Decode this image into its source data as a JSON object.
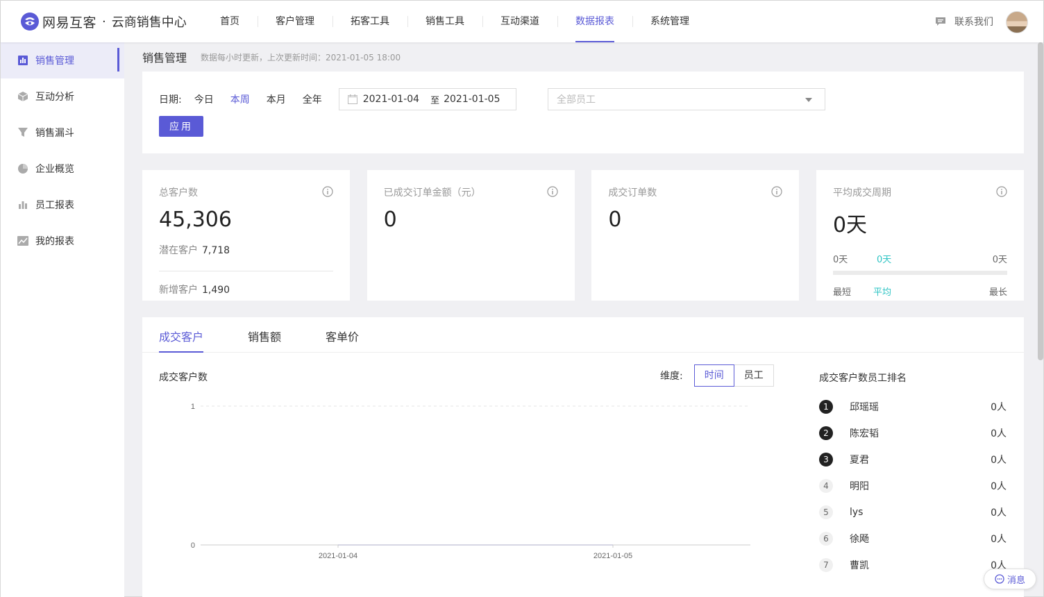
{
  "header": {
    "brand": "网易互客",
    "brand_dot": "·",
    "brand_sub": "云商销售中心",
    "nav": [
      "首页",
      "客户管理",
      "拓客工具",
      "销售工具",
      "互动渠道",
      "数据报表",
      "系统管理"
    ],
    "active_nav": "数据报表",
    "contact": "联系我们"
  },
  "sidebar": {
    "items": [
      {
        "label": "销售管理",
        "icon": "bar-chart-icon"
      },
      {
        "label": "互动分析",
        "icon": "cube-icon"
      },
      {
        "label": "销售漏斗",
        "icon": "funnel-icon"
      },
      {
        "label": "企业概览",
        "icon": "pie-chart-icon"
      },
      {
        "label": "员工报表",
        "icon": "column-chart-icon"
      },
      {
        "label": "我的报表",
        "icon": "line-chart-icon"
      }
    ],
    "active": "销售管理"
  },
  "page": {
    "title": "销售管理",
    "note": "数据每小时更新，上次更新时间：2021-01-05 18:00"
  },
  "filter": {
    "date_label": "日期:",
    "quick": [
      "今日",
      "本周",
      "本月",
      "全年"
    ],
    "active_quick": "本周",
    "date_start": "2021-01-04",
    "date_sep": "至",
    "date_end": "2021-01-05",
    "employee_placeholder": "全部员工",
    "apply_label": "应用"
  },
  "cards": {
    "total_customers": {
      "title": "总客户数",
      "value": "45,306",
      "potential_label": "潜在客户",
      "potential_value": "7,718",
      "new_label": "新增客户",
      "new_value": "1,490"
    },
    "deal_amount": {
      "title": "已成交订单金额（元）",
      "value": "0"
    },
    "deal_orders": {
      "title": "成交订单数",
      "value": "0"
    },
    "avg_cycle": {
      "title": "平均成交周期",
      "value": "0天",
      "min_value": "0天",
      "avg_value": "0天",
      "max_value": "0天",
      "min_label": "最短",
      "avg_label": "平均",
      "max_label": "最长"
    }
  },
  "panel": {
    "tabs": [
      "成交客户",
      "销售额",
      "客单价"
    ],
    "active_tab": "成交客户",
    "chart_title": "成交客户数",
    "dim_label": "维度:",
    "dim_options": [
      "时间",
      "员工"
    ],
    "dim_active": "时间",
    "rank_title": "成交客户数员工排名",
    "rank": [
      {
        "no": "1",
        "name": "邱瑶瑶",
        "value": "0人"
      },
      {
        "no": "2",
        "name": "陈宏韬",
        "value": "0人"
      },
      {
        "no": "3",
        "name": "夏君",
        "value": "0人"
      },
      {
        "no": "4",
        "name": "明阳",
        "value": "0人"
      },
      {
        "no": "5",
        "name": "lys",
        "value": "0人"
      },
      {
        "no": "6",
        "name": "徐飏",
        "value": "0人"
      },
      {
        "no": "7",
        "name": "曹凯",
        "value": "0人"
      }
    ]
  },
  "chart_data": {
    "type": "line",
    "x": [
      "2021-01-04",
      "2021-01-05"
    ],
    "series": [
      {
        "values": [
          0,
          0
        ]
      }
    ],
    "yticks": [
      "0",
      "1"
    ],
    "ylim": [
      0,
      1
    ]
  },
  "message_button": "消息",
  "colors": {
    "accent": "#5a5ad6",
    "teal": "#2ec4c4"
  }
}
